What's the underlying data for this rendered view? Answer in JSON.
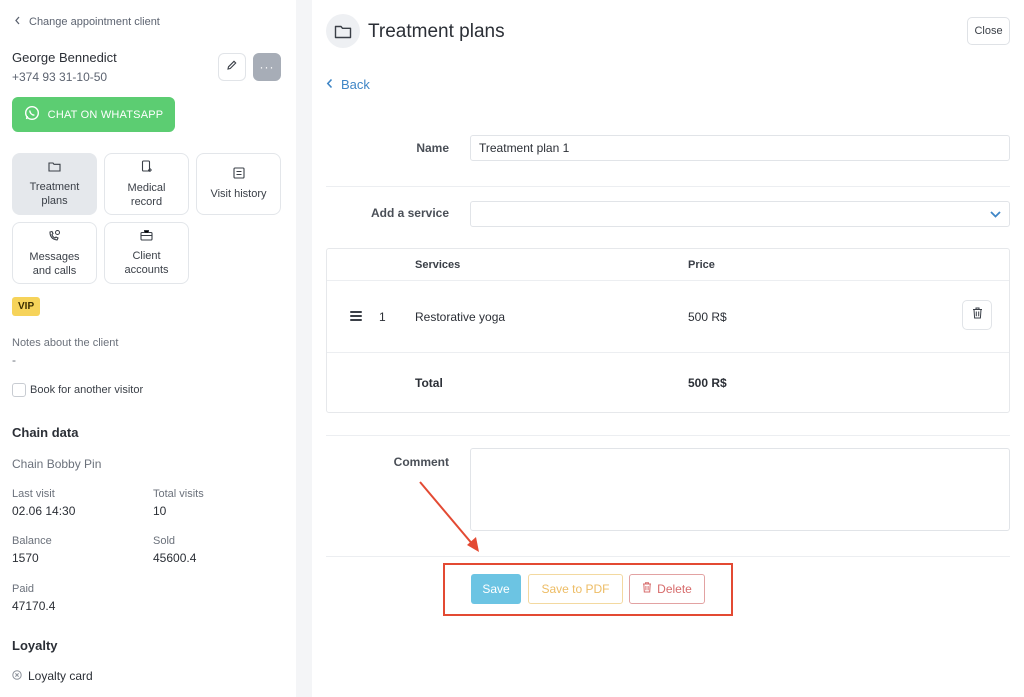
{
  "sidebar": {
    "back_label": "Change appointment client",
    "client": {
      "name": "George Bennedict",
      "phone": "+374 93 31-10-50"
    },
    "more_label": "···",
    "whatsapp_label": "CHAT ON WHATSAPP",
    "tiles": [
      {
        "label": "Treatment\nplans",
        "icon": "folder-icon"
      },
      {
        "label": "Medical\nrecord",
        "icon": "medical-record-icon"
      },
      {
        "label": "Visit history",
        "icon": "list-icon"
      },
      {
        "label": "Messages\nand calls",
        "icon": "phone-chat-icon"
      },
      {
        "label": "Client\naccounts",
        "icon": "briefcase-icon"
      }
    ],
    "badge": "VIP",
    "notes": {
      "label": "Notes about the client",
      "value": "-"
    },
    "book_another_label": "Book for another visitor",
    "chain": {
      "title": "Chain data",
      "name": "Chain Bobby Pin",
      "last_visit_label": "Last visit",
      "last_visit_value": "02.06 14:30",
      "total_visits_label": "Total visits",
      "total_visits_value": "10",
      "balance_label": "Balance",
      "balance_value": "1570",
      "sold_label": "Sold",
      "sold_value": "45600.4",
      "paid_label": "Paid",
      "paid_value": "47170.4"
    },
    "loyalty": {
      "title": "Loyalty",
      "card_label": "Loyalty card"
    }
  },
  "main": {
    "title": "Treatment plans",
    "close_label": "Close",
    "back_label": "Back",
    "name_label": "Name",
    "name_value": "Treatment plan 1",
    "add_service_label": "Add a service",
    "table": {
      "headers": {
        "services": "Services",
        "price": "Price"
      },
      "rows": [
        {
          "index": "1",
          "service": "Restorative yoga",
          "price": "500 R$"
        }
      ],
      "total_label": "Total",
      "total_value": "500 R$"
    },
    "comment_label": "Comment",
    "buttons": {
      "save": "Save",
      "save_pdf": "Save to PDF",
      "delete": "Delete"
    }
  },
  "colors": {
    "accent_link": "#3f86c6",
    "whatsapp": "#5ccd72",
    "save": "#6cc4e3",
    "pdf": "#edbc64",
    "delete": "#d76b6b",
    "highlight": "#e34a33",
    "vip": "#f6d35a"
  }
}
